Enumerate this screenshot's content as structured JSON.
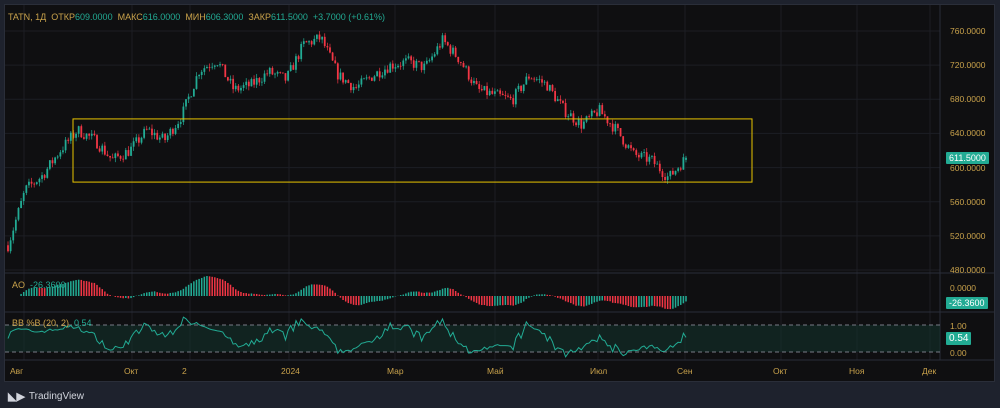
{
  "header": {
    "symbol": "TATN, 1Д",
    "open_label": "ОТКР",
    "open": "609.0000",
    "high_label": "МАКС",
    "high": "616.0000",
    "low_label": "МИН",
    "low": "606.3000",
    "close_label": "ЗАКР",
    "close": "611.5000",
    "change": "+3.7000 (+0.61%)"
  },
  "indicators": {
    "ao_label": "AO",
    "ao_value": "-26.3600",
    "ao_zero": "0.0000",
    "bb_label": "BB %B (20, 2)",
    "bb_value": "0.54",
    "bb_upper": "1.00",
    "bb_lower": "0.00"
  },
  "price_tag": "611.5000",
  "colors": {
    "up": "#22ab94",
    "down": "#f23645",
    "box": "#e8c400",
    "label": "#c9a24b"
  },
  "footer": {
    "brand": "TradingView"
  },
  "chart_data": {
    "type": "candlestick",
    "title": "TATN, 1Д",
    "ylim": [
      480,
      760
    ],
    "y_ticks": [
      "760.0000",
      "720.0000",
      "680.0000",
      "640.0000",
      "600.0000",
      "560.0000",
      "520.0000",
      "480.0000"
    ],
    "x_ticks": [
      "Авг",
      "Окт",
      "2",
      "2024",
      "Мар",
      "Май",
      "Июл",
      "Сен",
      "Окт",
      "Ноя",
      "Дек"
    ],
    "approx_close_path": [
      509,
      574,
      591,
      620,
      644,
      632,
      609,
      620,
      644,
      632,
      661,
      714,
      726,
      691,
      697,
      712,
      703,
      744,
      752,
      708,
      693,
      708,
      720,
      724,
      717,
      749,
      726,
      691,
      685,
      679,
      708,
      697,
      667,
      650,
      667,
      644,
      615,
      609,
      588,
      611.5
    ],
    "range_box": {
      "top": 657,
      "bottom": 583
    }
  }
}
